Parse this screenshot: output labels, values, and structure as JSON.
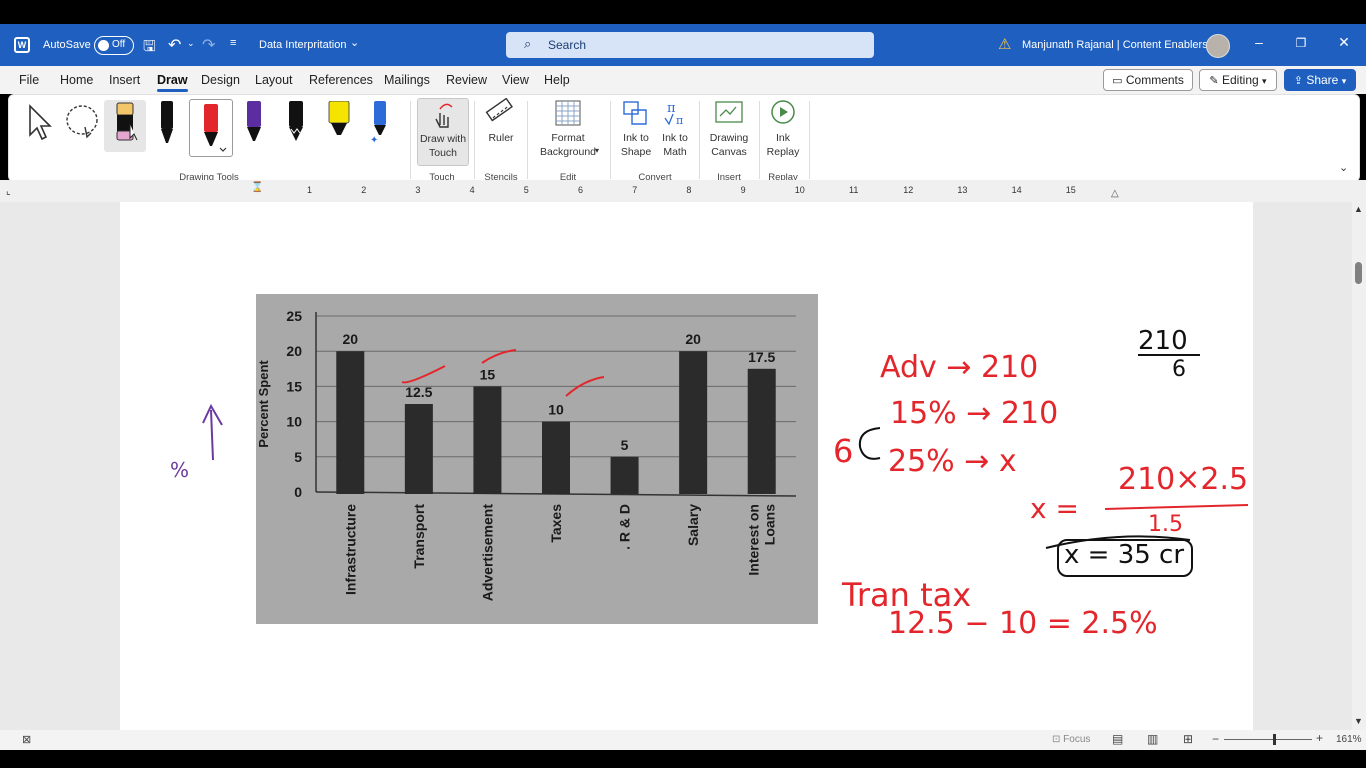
{
  "titlebar": {
    "autosave_label": "AutoSave",
    "autosave_state": "Off",
    "doc_title": "Data Interpritation",
    "search_placeholder": "Search",
    "user_name": "Manjunath Rajanal | Content Enablers"
  },
  "menu": {
    "items": [
      "File",
      "Home",
      "Insert",
      "Draw",
      "Design",
      "Layout",
      "References",
      "Mailings",
      "Review",
      "View",
      "Help"
    ],
    "active": "Draw",
    "comments": "Comments",
    "editing": "Editing",
    "share": "Share"
  },
  "ribbon": {
    "groups": {
      "drawing_tools": "Drawing Tools",
      "touch": "Touch",
      "stencils": "Stencils",
      "edit": "Edit",
      "convert": "Convert",
      "insert": "Insert",
      "replay": "Replay"
    },
    "draw_with_touch": [
      "Draw with",
      "Touch"
    ],
    "ruler": "Ruler",
    "format_background": [
      "Format",
      "Background"
    ],
    "ink_to_shape": [
      "Ink to",
      "Shape"
    ],
    "ink_to_math": [
      "Ink to",
      "Math"
    ],
    "drawing_canvas": [
      "Drawing",
      "Canvas"
    ],
    "ink_replay": [
      "Ink",
      "Replay"
    ],
    "pen_colors": [
      "#000000",
      "#e3262c",
      "#5a2ea0",
      "#000000",
      "#f5e400",
      "#2f6bd8"
    ]
  },
  "ruler": {
    "numbers": [
      "1",
      "2",
      "3",
      "4",
      "5",
      "6",
      "7",
      "8",
      "9",
      "10",
      "11",
      "12",
      "13",
      "14",
      "15"
    ]
  },
  "chart_data": {
    "type": "bar",
    "categories": [
      "Infrastructure",
      "Transport",
      "Advertisement",
      "Taxes",
      ". R & D",
      "Salary",
      "Interest on Loans"
    ],
    "values": [
      20,
      12.5,
      15,
      10,
      5,
      20,
      17.5
    ],
    "value_labels": [
      "20",
      "12.5",
      "15",
      "10",
      "5",
      "20",
      "17.5"
    ],
    "ylabel": "Percent Spent",
    "yticks": [
      "0",
      "5",
      "10",
      "15",
      "20",
      "25"
    ],
    "ylim": [
      0,
      25
    ],
    "grid": true
  },
  "annotations": {
    "left_axis_note": "%",
    "adv_line": "Adv → 210",
    "fraction_top": "210",
    "fraction_bottom": "6",
    "six": "6",
    "pct15_line": "15% → 210",
    "pct25_line": "25% → x",
    "eq_left": "x =",
    "eq_num": "210×2.5",
    "eq_den": "1.5",
    "result": "x = 35 cr",
    "tran_tax": "Tran tax",
    "calc": "12.5 − 10 = 2.5%"
  },
  "statusbar": {
    "focus": "Focus",
    "zoom": "161%"
  }
}
